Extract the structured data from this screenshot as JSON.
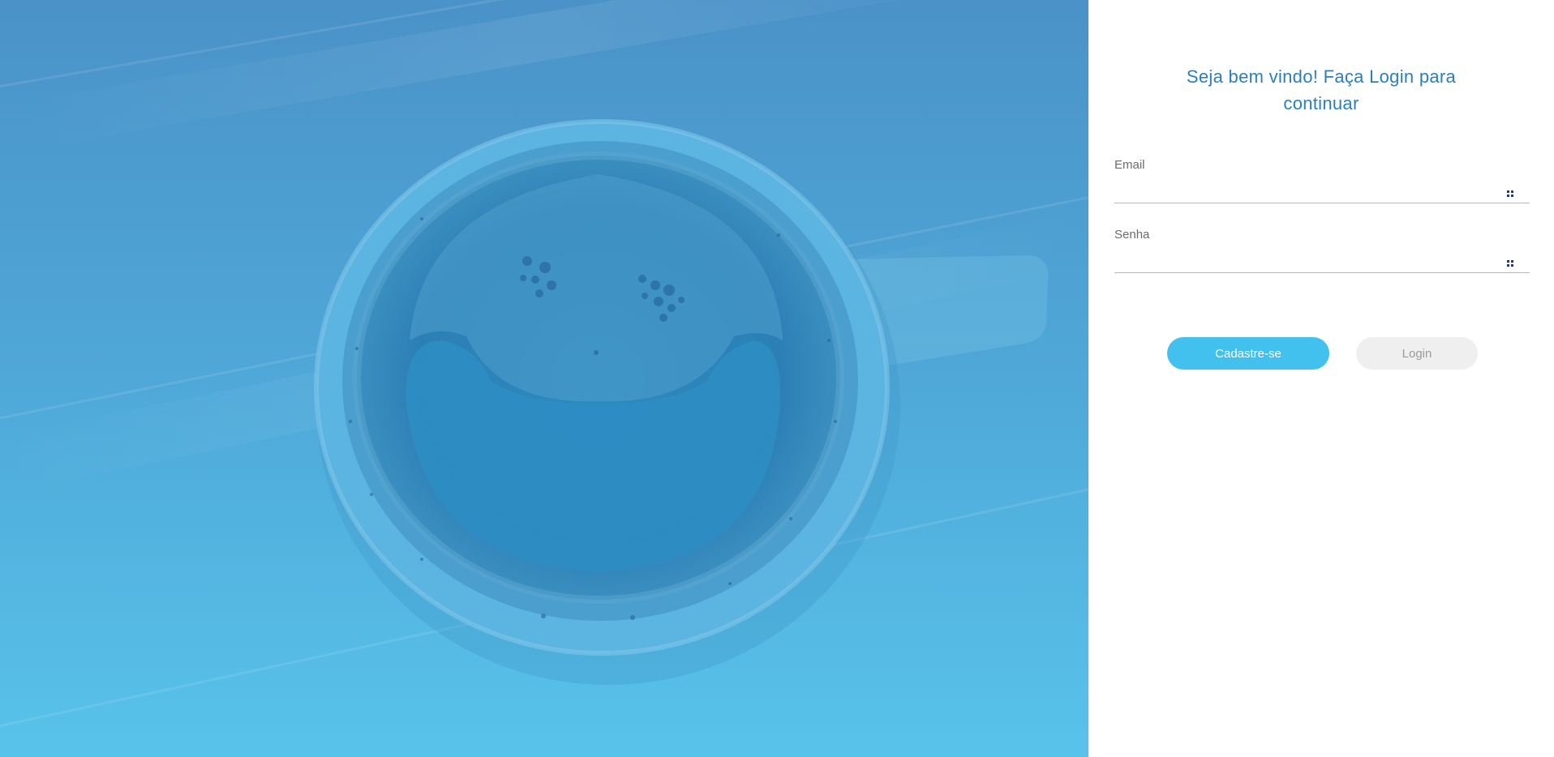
{
  "hero": {
    "image": "coffee-cup-photo",
    "overlay_color": "#4fa8d8"
  },
  "login": {
    "title_line1": "Seja bem vindo! Faça Login para",
    "title_line2": "continuar",
    "email": {
      "label": "Email",
      "value": "",
      "placeholder": "",
      "icon": "key-icon"
    },
    "password": {
      "label": "Senha",
      "value": "",
      "placeholder": "",
      "icon": "key-icon"
    },
    "signup_button": "Cadastre-se",
    "login_button": "Login"
  },
  "colors": {
    "accent": "#42c1ee",
    "title": "#2a7fbc",
    "disabled_button": "#efefef"
  }
}
